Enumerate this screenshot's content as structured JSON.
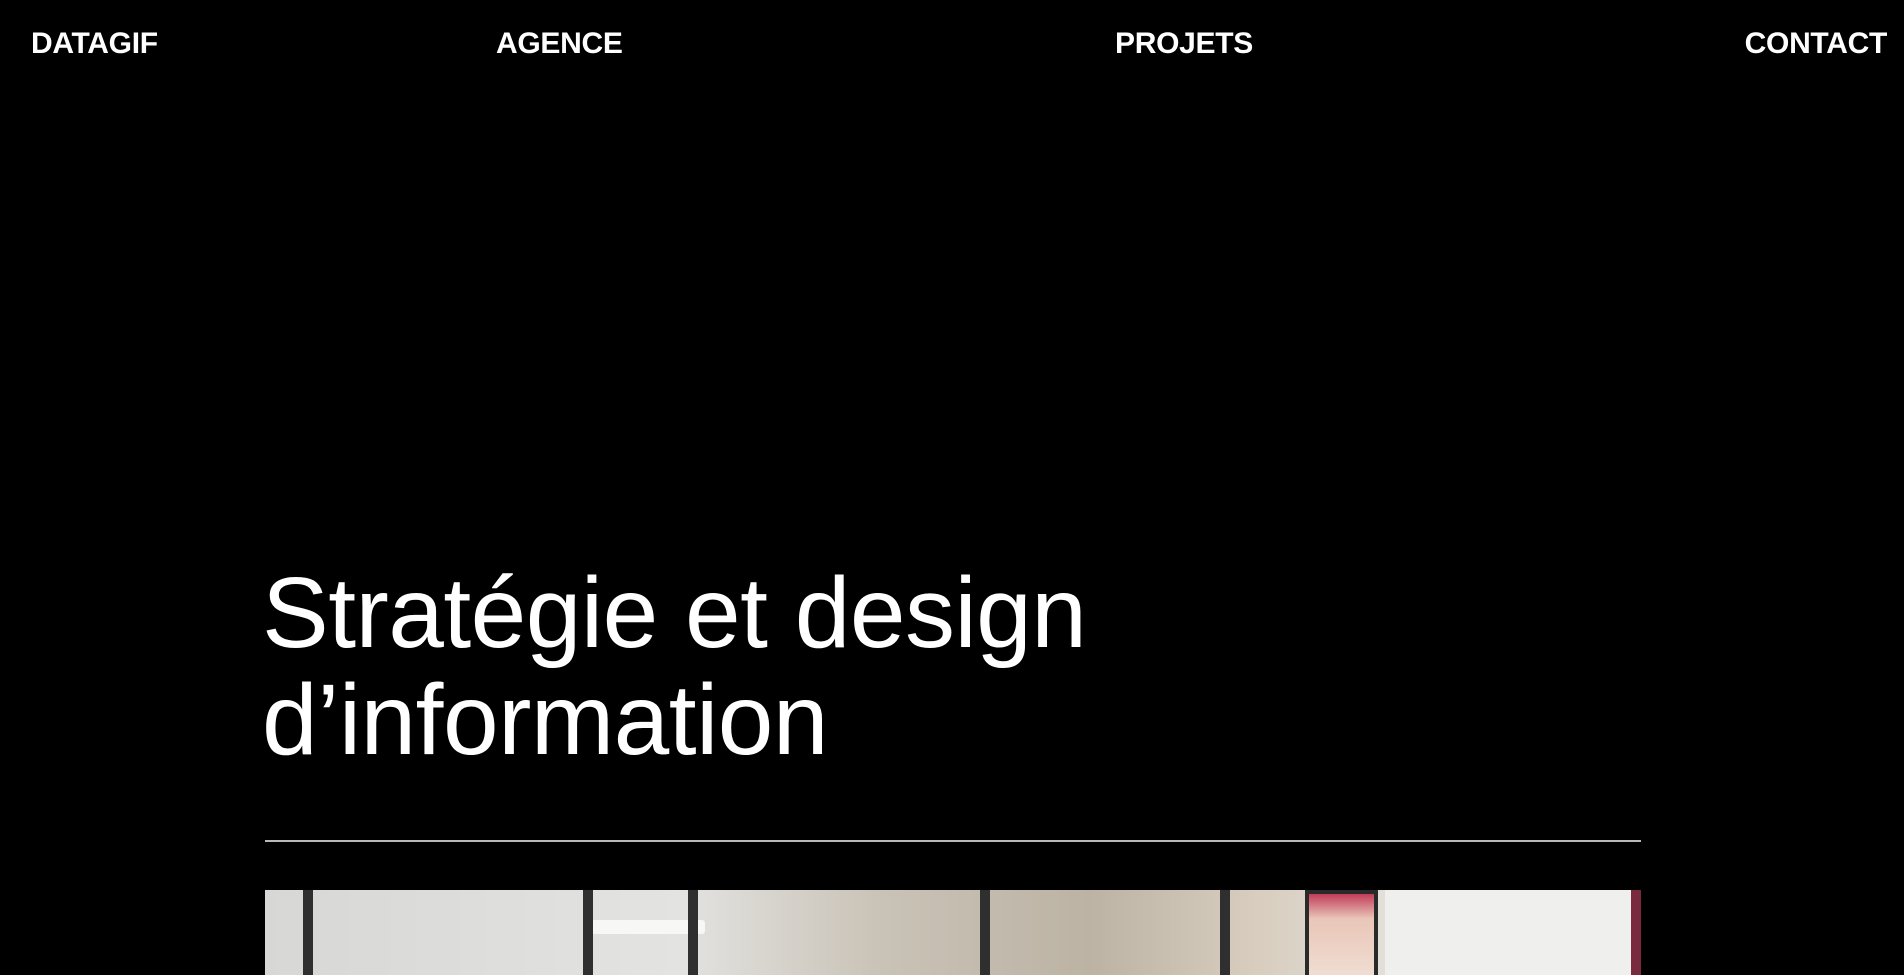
{
  "nav": {
    "logo": "DATAGIF",
    "items": [
      "AGENCE",
      "PROJETS",
      "CONTACT"
    ]
  },
  "hero": {
    "title_lines": [
      "Stratégie et design",
      "d’information"
    ],
    "image_alt": "agency office"
  },
  "colors": {
    "background": "#000000",
    "text": "#ffffff",
    "divider": "#b9b9b9"
  }
}
